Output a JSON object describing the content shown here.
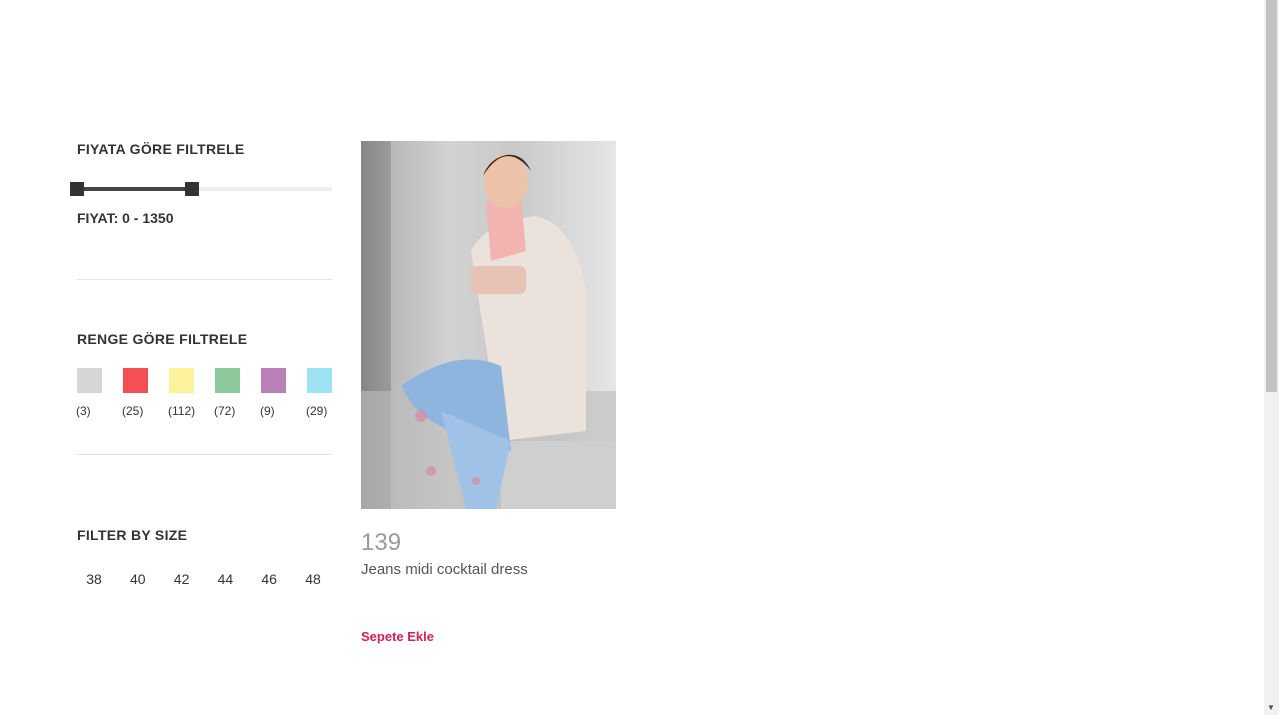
{
  "filters": {
    "price": {
      "title": "FIYATA GÖRE FILTRELE",
      "label": "FIYAT: 0 - 1350",
      "slider_low_fraction": 0.0,
      "slider_high_fraction": 0.45
    },
    "color": {
      "title": "RENGE GÖRE FILTRELE",
      "swatches": [
        {
          "color": "#d6d6d6",
          "count": "(3)"
        },
        {
          "color": "#f44f54",
          "count": "(25)"
        },
        {
          "color": "#fbf29a",
          "count": "(112)"
        },
        {
          "color": "#8cc99a",
          "count": "(72)"
        },
        {
          "color": "#b97fb6",
          "count": "(9)"
        },
        {
          "color": "#9ee3f3",
          "count": "(29)"
        }
      ]
    },
    "size": {
      "title": "FILTER BY SIZE",
      "options": [
        "38",
        "40",
        "42",
        "44",
        "46",
        "48"
      ]
    }
  },
  "product": {
    "price": "139",
    "name": "Jeans midi cocktail dress",
    "cart_label": "Sepete Ekle"
  },
  "colors": {
    "accent": "#d0215a",
    "price_gray": "#9a9a9a"
  }
}
